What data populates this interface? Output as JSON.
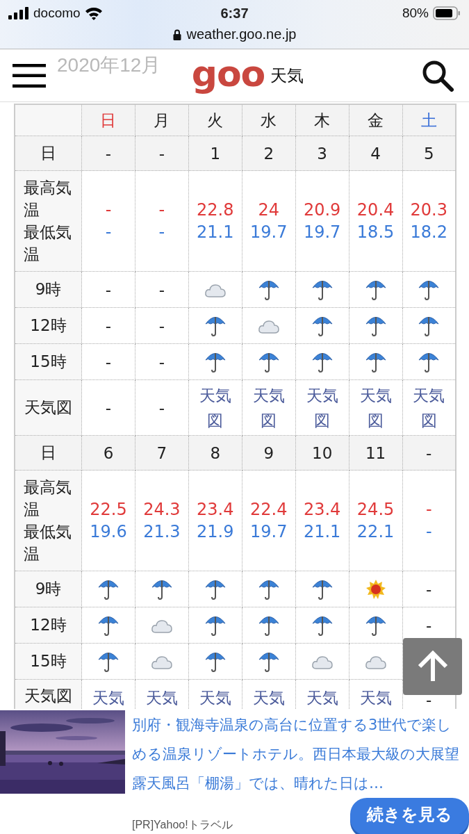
{
  "status_bar": {
    "carrier": "docomo",
    "time": "6:37",
    "battery": "80%"
  },
  "url_bar": {
    "url": "weather.goo.ne.jp"
  },
  "header": {
    "faded_title": "2020年12月",
    "logo": "goo",
    "section": "天気"
  },
  "table": {
    "weekdays": [
      {
        "label": "日",
        "color": "#e03a3a"
      },
      {
        "label": "月",
        "color": "#222222"
      },
      {
        "label": "火",
        "color": "#222222"
      },
      {
        "label": "水",
        "color": "#222222"
      },
      {
        "label": "木",
        "color": "#222222"
      },
      {
        "label": "金",
        "color": "#222222"
      },
      {
        "label": "土",
        "color": "#3a6fd8"
      }
    ],
    "weeks": [
      {
        "day_label": "日",
        "days": [
          "-",
          "-",
          "1",
          "2",
          "3",
          "4",
          "5"
        ],
        "temp_labels": [
          "最高気温",
          "最低気温"
        ],
        "highs": [
          "-",
          "-",
          "22.8",
          "24",
          "20.9",
          "20.4",
          "20.3"
        ],
        "lows": [
          "-",
          "-",
          "21.1",
          "19.7",
          "19.7",
          "18.5",
          "18.2"
        ],
        "hours": [
          {
            "label": "9時",
            "cells": [
              {
                "kind": "text",
                "text": "-"
              },
              {
                "kind": "text",
                "text": "-"
              },
              {
                "kind": "cloud"
              },
              {
                "kind": "rain"
              },
              {
                "kind": "rain"
              },
              {
                "kind": "rain"
              },
              {
                "kind": "rain"
              }
            ]
          },
          {
            "label": "12時",
            "cells": [
              {
                "kind": "text",
                "text": "-"
              },
              {
                "kind": "text",
                "text": "-"
              },
              {
                "kind": "rain"
              },
              {
                "kind": "cloud"
              },
              {
                "kind": "rain"
              },
              {
                "kind": "rain"
              },
              {
                "kind": "rain"
              }
            ]
          },
          {
            "label": "15時",
            "cells": [
              {
                "kind": "text",
                "text": "-"
              },
              {
                "kind": "text",
                "text": "-"
              },
              {
                "kind": "rain"
              },
              {
                "kind": "rain"
              },
              {
                "kind": "rain"
              },
              {
                "kind": "rain"
              },
              {
                "kind": "rain"
              }
            ]
          }
        ],
        "map_label": "天気図",
        "maps": [
          {
            "kind": "text",
            "text": "-"
          },
          {
            "kind": "text",
            "text": "-"
          },
          {
            "kind": "link",
            "text": "天気図"
          },
          {
            "kind": "link",
            "text": "天気図"
          },
          {
            "kind": "link",
            "text": "天気図"
          },
          {
            "kind": "link",
            "text": "天気図"
          },
          {
            "kind": "link",
            "text": "天気図"
          }
        ]
      },
      {
        "day_label": "日",
        "days": [
          "6",
          "7",
          "8",
          "9",
          "10",
          "11",
          "-"
        ],
        "temp_labels": [
          "最高気温",
          "最低気温"
        ],
        "highs": [
          "22.5",
          "24.3",
          "23.4",
          "22.4",
          "23.4",
          "24.5",
          "-"
        ],
        "lows": [
          "19.6",
          "21.3",
          "21.9",
          "19.7",
          "21.1",
          "22.1",
          "-"
        ],
        "hours": [
          {
            "label": "9時",
            "cells": [
              {
                "kind": "rain"
              },
              {
                "kind": "rain"
              },
              {
                "kind": "rain"
              },
              {
                "kind": "rain"
              },
              {
                "kind": "rain"
              },
              {
                "kind": "sun"
              },
              {
                "kind": "text",
                "text": "-"
              }
            ]
          },
          {
            "label": "12時",
            "cells": [
              {
                "kind": "rain"
              },
              {
                "kind": "cloud"
              },
              {
                "kind": "rain"
              },
              {
                "kind": "rain"
              },
              {
                "kind": "rain"
              },
              {
                "kind": "rain"
              },
              {
                "kind": "text",
                "text": "-"
              }
            ]
          },
          {
            "label": "15時",
            "cells": [
              {
                "kind": "rain"
              },
              {
                "kind": "cloud"
              },
              {
                "kind": "rain"
              },
              {
                "kind": "rain"
              },
              {
                "kind": "cloud"
              },
              {
                "kind": "cloud"
              }
            ]
          }
        ],
        "map_label": "天気図",
        "maps": [
          {
            "kind": "link",
            "text": "天気"
          },
          {
            "kind": "link",
            "text": "天気"
          },
          {
            "kind": "link",
            "text": "天気"
          },
          {
            "kind": "link",
            "text": "天気"
          },
          {
            "kind": "link",
            "text": "天気"
          },
          {
            "kind": "link",
            "text": "天気"
          },
          {
            "kind": "text",
            "text": "-"
          }
        ]
      }
    ]
  },
  "ad": {
    "text": "別府・観海寺温泉の高台に位置する3世代で楽しめる温泉リゾートホテル。西日本最大級の大展望露天風呂「棚湯」では、晴れた日は…",
    "source": "[PR]Yahoo!トラベル",
    "button": "続きを見る"
  }
}
